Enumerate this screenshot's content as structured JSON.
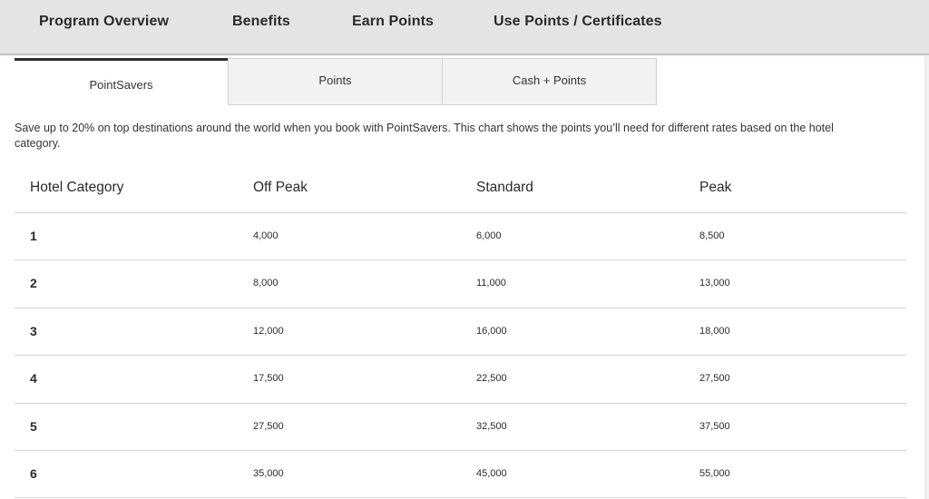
{
  "topnav": {
    "items": [
      {
        "label": "Program Overview"
      },
      {
        "label": "Benefits"
      },
      {
        "label": "Earn Points"
      },
      {
        "label": "Use Points / Certificates"
      }
    ]
  },
  "tabs": [
    {
      "label": "PointSavers",
      "active": true
    },
    {
      "label": "Points",
      "active": false
    },
    {
      "label": "Cash + Points",
      "active": false
    }
  ],
  "description": "Save up to 20% on top destinations around the world when you book with PointSavers. This chart shows the points you’ll need for different rates based on the hotel category.",
  "table": {
    "headers": [
      "Hotel Category",
      "Off Peak",
      "Standard",
      "Peak"
    ],
    "rows": [
      [
        "1",
        "4,000",
        "6,000",
        "8,500"
      ],
      [
        "2",
        "8,000",
        "11,000",
        "13,000"
      ],
      [
        "3",
        "12,000",
        "16,000",
        "18,000"
      ],
      [
        "4",
        "17,500",
        "22,500",
        "27,500"
      ],
      [
        "5",
        "27,500",
        "32,500",
        "37,500"
      ],
      [
        "6",
        "35,000",
        "45,000",
        "55,000"
      ]
    ]
  },
  "colors": {
    "nav_background": "#e4e4e4",
    "active_tab_indicator": "#2f2f2f",
    "inactive_tab_background": "#f2f2f2",
    "row_divider": "#d4d4d4"
  }
}
